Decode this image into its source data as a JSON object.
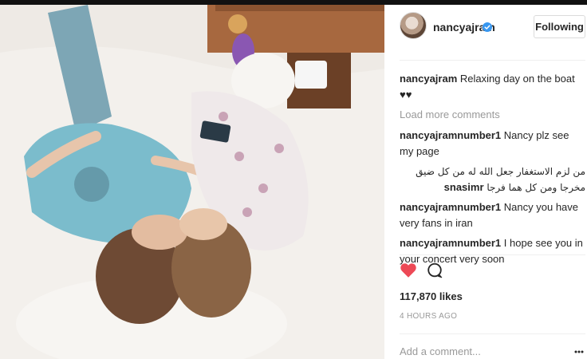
{
  "post": {
    "author": "nancyajram",
    "follow_label": "Following",
    "caption_user": "nancyajram",
    "caption_text": "Relaxing day on the boat ♥♥",
    "load_more": "Load more comments",
    "comments": [
      {
        "user": "nancyajramnumber1",
        "text": "Nancy plz see my page"
      },
      {
        "user": "snasimr",
        "text": "من لزم الاستغفار جعل الله له من كل ضيق مخرجا ومن كل هما فرجا"
      },
      {
        "user": "nancyajramnumber1",
        "text": "Nancy you have very fans in iran"
      },
      {
        "user": "nancyajramnumber1",
        "text": "I hope see you in your concert very soon"
      }
    ],
    "likes": "117,870 likes",
    "timestamp": "4 HOURS AGO",
    "add_comment_placeholder": "Add a comment...",
    "icons": {
      "verified": "verified-badge-icon",
      "like": "heart-icon",
      "comment": "comment-bubble-icon",
      "more": "more-options-icon"
    },
    "colors": {
      "heart": "#ed4956",
      "verified": "#3897f0",
      "muted": "#999999"
    }
  }
}
